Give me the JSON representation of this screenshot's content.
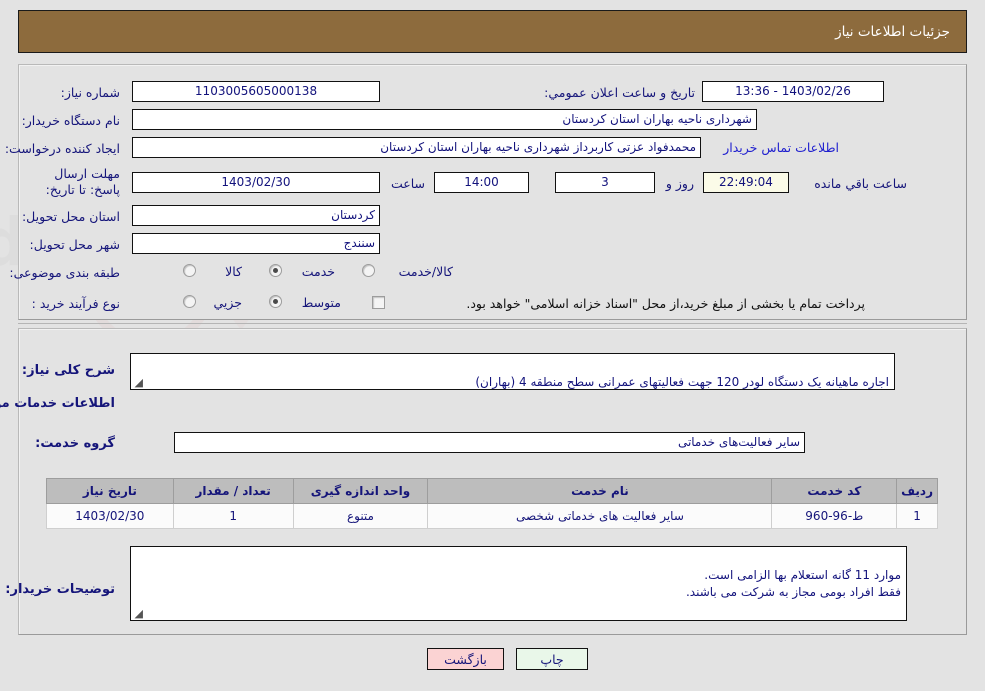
{
  "header": {
    "title": "جزئیات اطلاعات نیاز"
  },
  "top_section": {
    "need_number": {
      "label": "شماره نیاز:",
      "value": "1103005605000138"
    },
    "announce_datetime": {
      "label": "تاریخ و ساعت اعلان عمومي:",
      "value": "1403/02/26 - 13:36"
    },
    "buyer_org": {
      "label": "نام دستگاه خریدار:",
      "value": "شهرداری ناحیه بهاران استان کردستان"
    },
    "requester": {
      "label": "ایجاد کننده درخواست:",
      "value": "محمدفواد عزتی کاربرداز شهرداری ناحیه بهاران استان کردستان"
    },
    "buyer_contact_link": "اطلاعات تماس خریدار",
    "deadline": {
      "label": "مهلت ارسال پاسخ: تا تاریخ:",
      "date": "1403/02/30",
      "hour_label": "ساعت",
      "hour": "14:00",
      "days": "3",
      "days_label": "روز و",
      "countdown": "22:49:04",
      "countdown_label": "ساعت باقي مانده"
    },
    "delivery_province": {
      "label": "استان محل تحویل:",
      "value": "کردستان"
    },
    "delivery_city": {
      "label": "شهر محل تحویل:",
      "value": "سنندج"
    },
    "subject_category": {
      "label": "طبقه بندی موضوعی:",
      "options": [
        "کالا",
        "خدمت",
        "کالا/خدمت"
      ],
      "selected": "خدمت"
    },
    "purchase_process": {
      "label": "نوع فرآیند خرید :",
      "options": [
        "جزیي",
        "متوسط"
      ],
      "selected": "متوسط",
      "checkbox_note": "پرداخت تمام یا بخشی از مبلغ خرید،از محل \"اسناد خزانه اسلامی\" خواهد بود.",
      "checkbox_checked": false
    }
  },
  "mid_section": {
    "general_desc": {
      "label": "شرح کلی نیاز:",
      "value": "اجاره ماهیانه یک دستگاه لودر 120 جهت فعالیتهای عمرانی سطح منطقه 4 (بهاران)"
    },
    "services_heading": "اطلاعات خدمات مورد نیاز",
    "service_group": {
      "label": "گروه خدمت:",
      "value": "سایر فعالیت‌های خدماتی"
    },
    "table": {
      "columns": [
        "ردیف",
        "کد خدمت",
        "نام خدمت",
        "واحد اندازه گیری",
        "تعداد / مقدار",
        "تاریخ نیاز"
      ],
      "rows": [
        {
          "row_no": "1",
          "service_code": "ط-96-960",
          "service_name": "سایر فعالیت های خدماتی شخصی",
          "unit": "متنوع",
          "quantity": "1",
          "need_date": "1403/02/30"
        }
      ]
    },
    "buyer_notes": {
      "label": "توضیحات خریدار:",
      "value": "موارد 11 گانه استعلام بها الزامی است.\nفقط افراد بومی مجاز به شرکت می باشند."
    }
  },
  "footer": {
    "print_label": "چاپ",
    "back_label": "بازگشت"
  },
  "watermark": {
    "text": "AriaTender.net"
  },
  "colors": {
    "header_bg": "#8d6b3d",
    "page_bg": "#e3e3e3",
    "label_text": "#15157a",
    "link": "#2020cf",
    "table_header_bg": "#bdbdbd",
    "print_btn": "#e9f7e9",
    "back_btn": "#fbd3d3",
    "countdown_bg": "#fbfbe8"
  }
}
